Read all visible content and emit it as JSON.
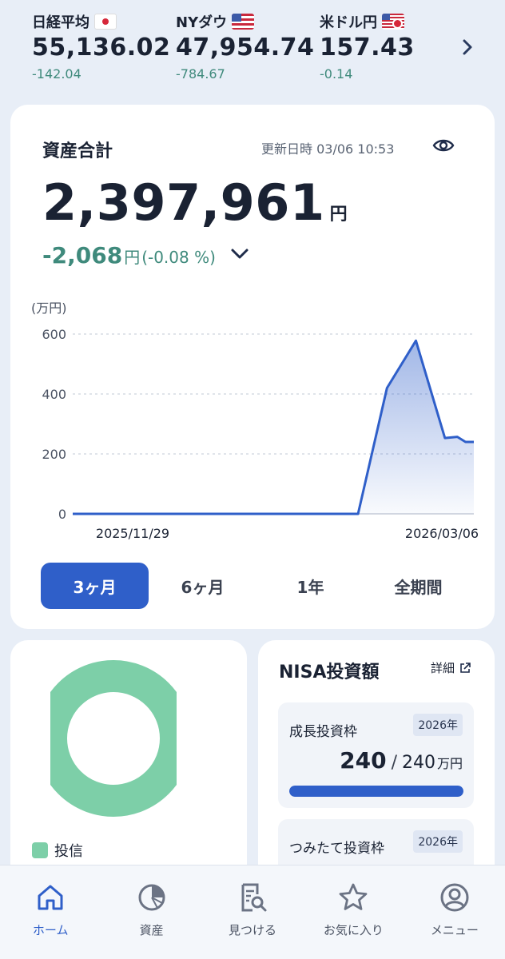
{
  "ticker": {
    "items": [
      {
        "name": "日経平均",
        "flag": "jp",
        "value": "55,136.02",
        "change": "-142.04"
      },
      {
        "name": "NYダウ",
        "flag": "us",
        "value": "47,954.74",
        "change": "-784.67"
      },
      {
        "name": "米ドル円",
        "flag": "usjp",
        "value": "157.43",
        "change": "-0.14"
      }
    ],
    "next_icon": "chevron-right-icon"
  },
  "asset": {
    "title": "資産合計",
    "updated": "更新日時 03/06 10:53",
    "total_value": "2,397,961",
    "total_unit": "円",
    "diff_value": "-2,068",
    "diff_unit": "円",
    "diff_pct": "(-0.08 %)"
  },
  "chart_data": {
    "type": "area",
    "ylabel": "(万円)",
    "ylim": [
      0,
      600
    ],
    "yticks": [
      "600",
      "400",
      "200",
      "0"
    ],
    "x_labels": [
      "2025/11/29",
      "2026/03/06"
    ],
    "x": [
      "2025/11/29",
      "2026/02/06",
      "2026/02/13",
      "2026/02/20",
      "2026/02/27",
      "2026/03/02",
      "2026/03/04",
      "2026/03/06"
    ],
    "values": [
      0,
      0,
      420,
      578,
      253,
      257,
      240,
      240
    ],
    "grid": true,
    "color": "#2f5fc9"
  },
  "periods": {
    "items": [
      "3ヶ月",
      "6ヶ月",
      "1年",
      "全期間"
    ],
    "active_index": 0
  },
  "allocation": {
    "legend": [
      {
        "label": "投信",
        "color": "#7dcfa8",
        "share": 1.0
      }
    ]
  },
  "nisa": {
    "title": "NISA投資額",
    "detail_label": "詳細",
    "growth": {
      "title": "成長投資枠",
      "year": "2026年",
      "used": "240",
      "limit": "240",
      "unit": "万円",
      "progress": 1.0
    },
    "tsumitate": {
      "title": "つみたて投資枠",
      "year": "2026年"
    }
  },
  "nav": {
    "items": [
      {
        "label": "ホーム",
        "icon": "home-icon",
        "active": true
      },
      {
        "label": "資産",
        "icon": "pie-chart-icon",
        "active": false
      },
      {
        "label": "見つける",
        "icon": "search-document-icon",
        "active": false
      },
      {
        "label": "お気に入り",
        "icon": "star-icon",
        "active": false
      },
      {
        "label": "メニュー",
        "icon": "user-icon",
        "active": false
      }
    ]
  }
}
